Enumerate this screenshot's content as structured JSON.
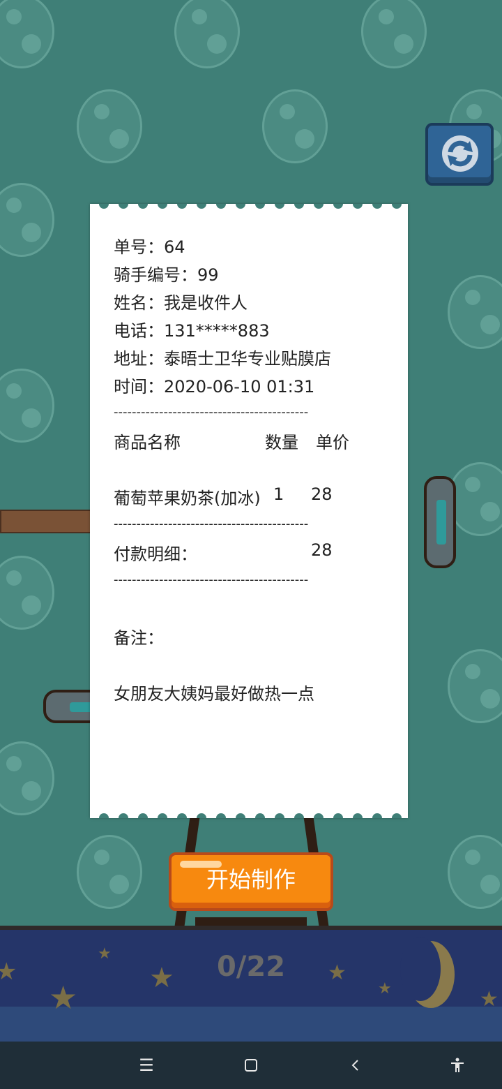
{
  "receipt": {
    "order_no": "单号：64",
    "rider_no": "骑手编号：99",
    "name": "姓名：我是收件人",
    "phone": "电话：131*****883",
    "address": "地址：泰晤士卫华专业贴膜店",
    "time": "时间：2020-06-10 01:31",
    "divider": "-------------------------------------------",
    "header_product": "商品名称",
    "header_qty": "数量",
    "header_price": "单价",
    "item_name": "葡萄苹果奶茶(加冰)",
    "item_qty": "1",
    "item_price": "28",
    "payment_label": "付款明细：",
    "payment_total": "28",
    "note_label": "备注：",
    "note_text": "女朋友大姨妈最好做热一点"
  },
  "start_button_label": "开始制作",
  "progress_counter": "0/22",
  "icons": {
    "refresh": "refresh-icon",
    "menu": "menu-icon",
    "home": "home-icon",
    "back": "back-icon",
    "accessibility": "accessibility-icon"
  },
  "colors": {
    "background": "#3f7f77",
    "start_button": "#f7890f",
    "refresh_button": "#2f6496",
    "night_band": "#253569"
  }
}
